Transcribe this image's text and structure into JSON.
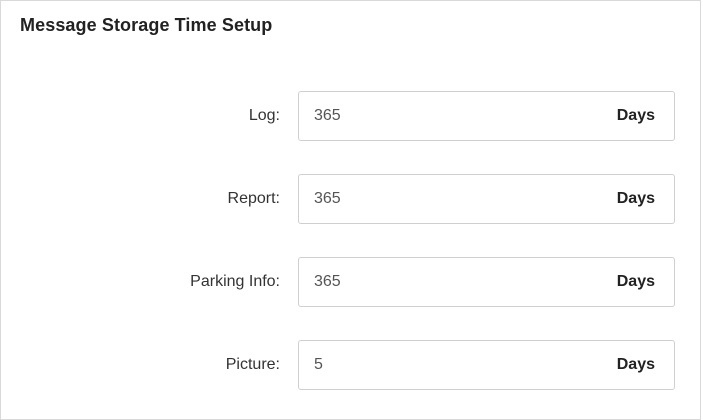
{
  "panel": {
    "title": "Message Storage Time Setup"
  },
  "fields": [
    {
      "label": "Log:",
      "value": "365",
      "unit": "Days"
    },
    {
      "label": "Report:",
      "value": "365",
      "unit": "Days"
    },
    {
      "label": "Parking Info:",
      "value": "365",
      "unit": "Days"
    },
    {
      "label": "Picture:",
      "value": "5",
      "unit": "Days"
    }
  ]
}
